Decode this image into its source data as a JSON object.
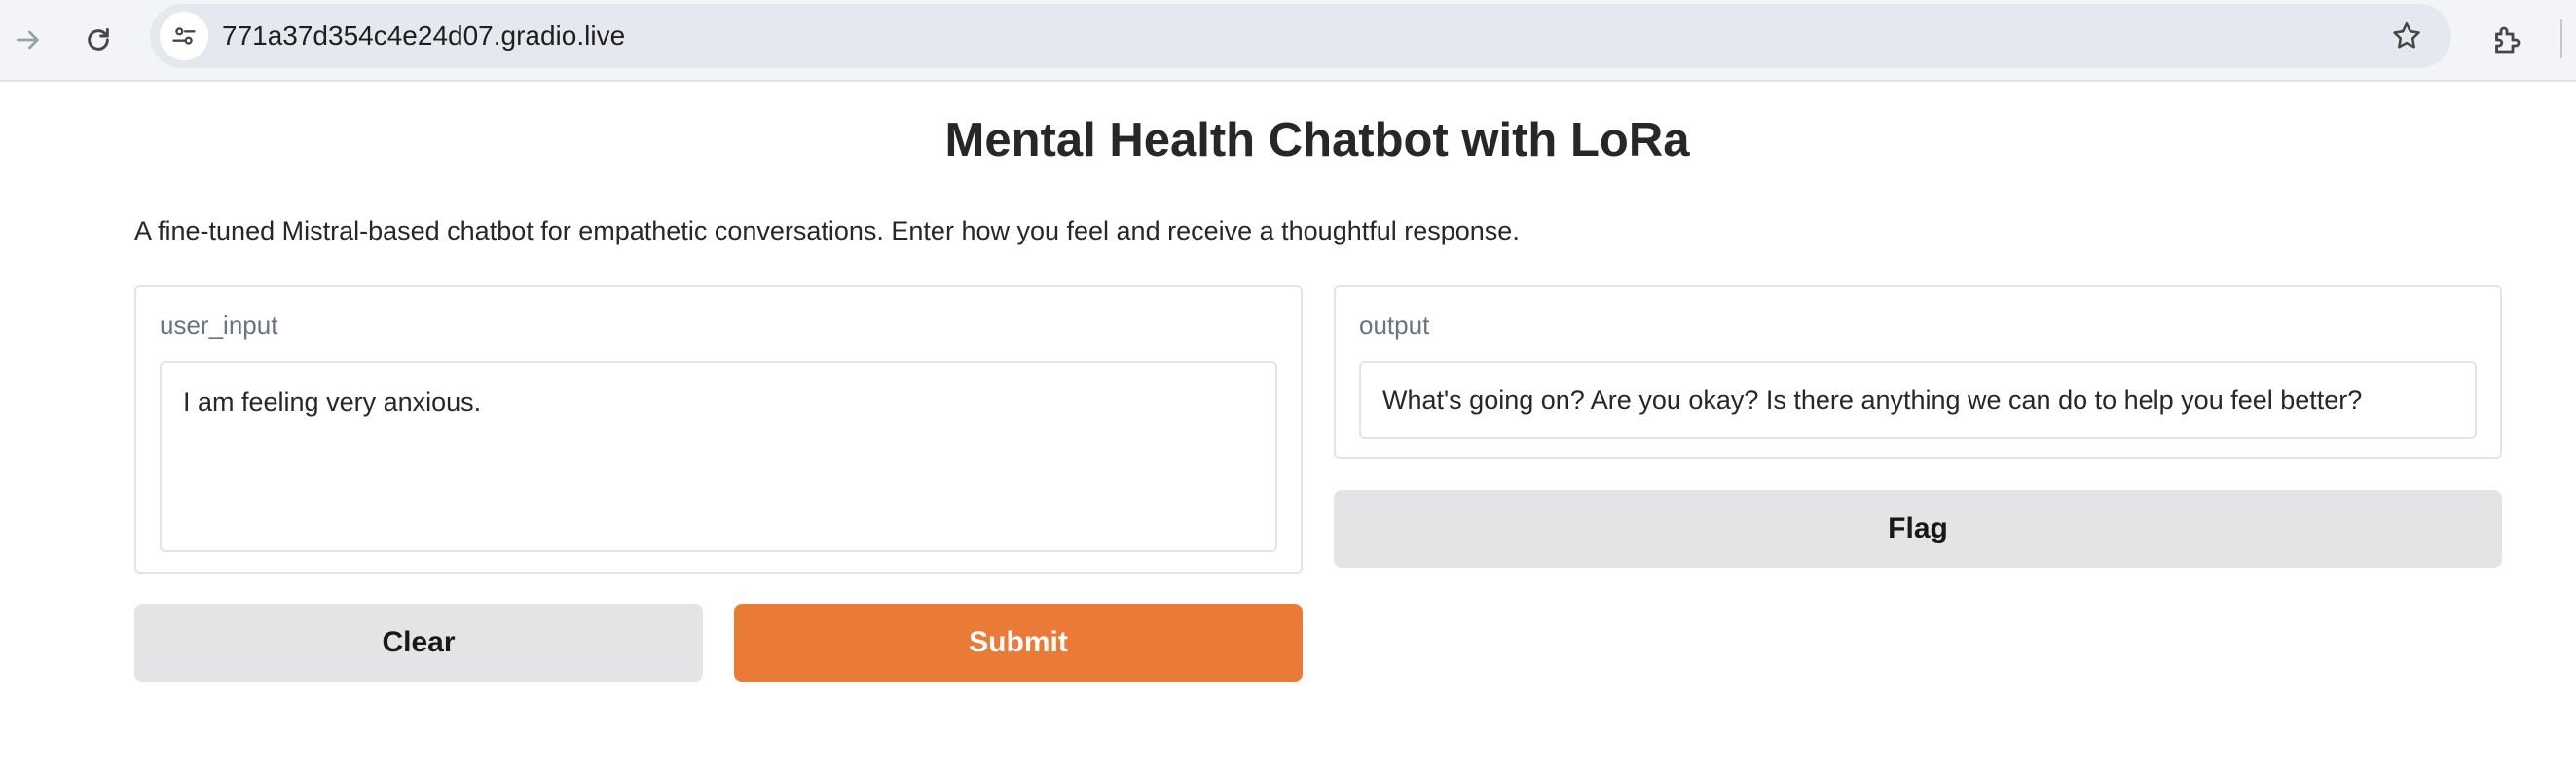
{
  "browser": {
    "url": "771a37d354c4e24d07.gradio.live",
    "icons": [
      "forward-arrow-icon",
      "reload-icon",
      "site-info-icon",
      "bookmark-star-icon",
      "extensions-icon"
    ]
  },
  "app": {
    "title": "Mental Health Chatbot with LoRa",
    "description": "A fine-tuned Mistral-based chatbot for empathetic conversations. Enter how you feel and receive a thoughtful response."
  },
  "input_panel": {
    "label": "user_input",
    "value": "I am feeling very anxious."
  },
  "output_panel": {
    "label": "output",
    "value": "What's going on? Are you okay? Is there anything we can do to help you feel better?"
  },
  "buttons": {
    "clear": "Clear",
    "submit": "Submit",
    "flag": "Flag"
  },
  "colors": {
    "accent": "#ea7b36",
    "secondary_button": "#e4e4e7"
  }
}
